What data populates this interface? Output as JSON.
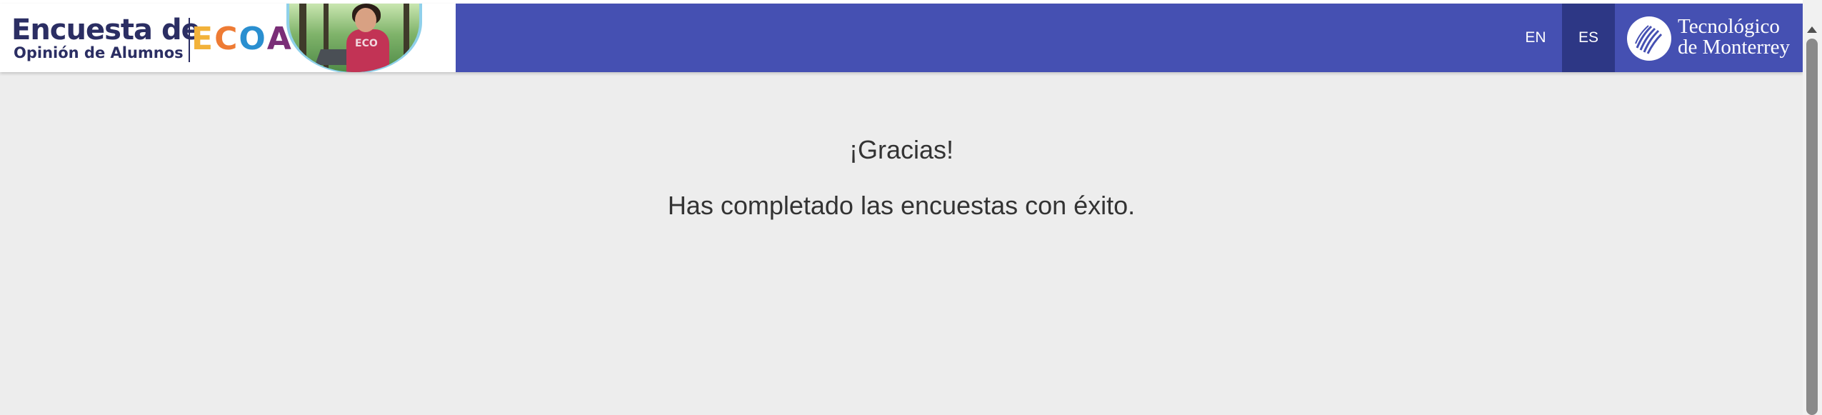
{
  "header": {
    "brand_title": "Encuesta de",
    "brand_subtitle": "Opinión de Alumnos",
    "ecoa_letters": [
      "E",
      "C",
      "O",
      "A"
    ],
    "shirt_text": "ECO",
    "accent_color": "#4550b2",
    "active_lang_color": "#2d3785"
  },
  "language": {
    "options": [
      "EN",
      "ES"
    ],
    "selected": "ES"
  },
  "institution": {
    "name_line1": "Tecnológico",
    "name_line2": "de Monterrey"
  },
  "main": {
    "title": "¡Gracias!",
    "message": "Has completado las encuestas con éxito."
  },
  "icons": {
    "logo": "tec-de-monterrey-logo-icon",
    "scroll_up": "scroll-up-arrow-icon"
  }
}
